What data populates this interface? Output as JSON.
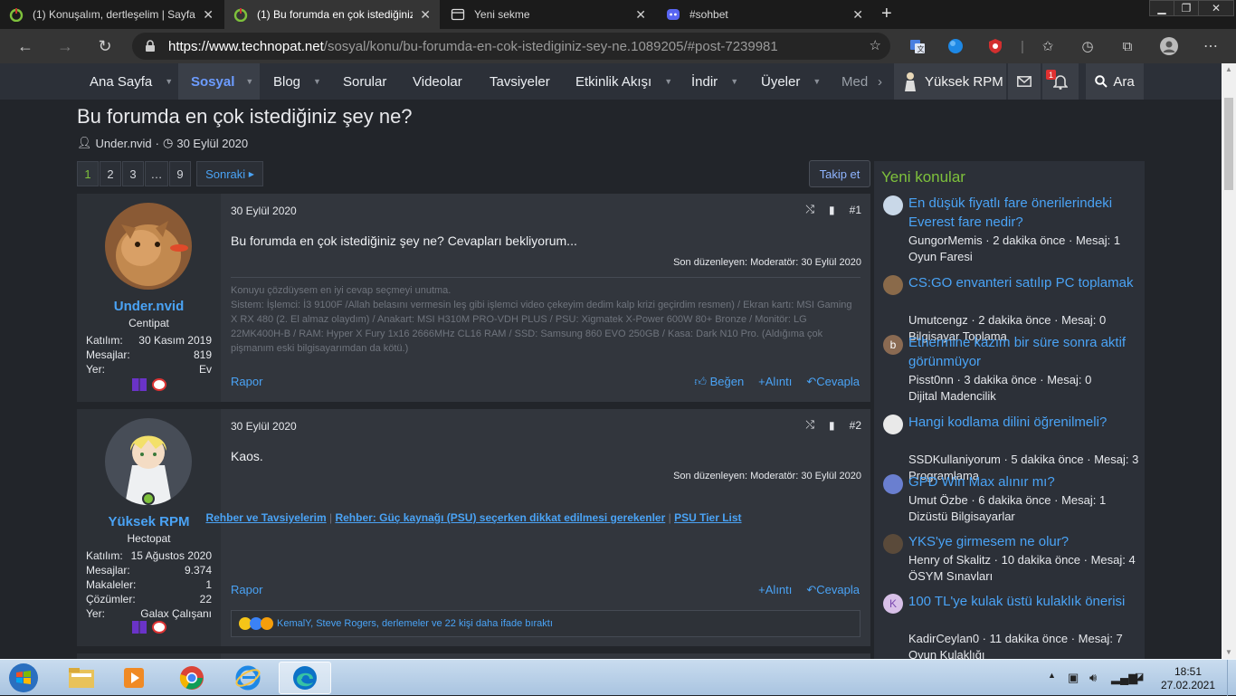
{
  "browser": {
    "tabs": [
      {
        "title": "(1) Konuşalım, dertleşelim | Sayfa",
        "icon": "technopat-icon",
        "active": false
      },
      {
        "title": "(1) Bu forumda en çok istediğiniz",
        "icon": "technopat-icon",
        "active": true
      },
      {
        "title": "Yeni sekme",
        "icon": "new-tab-icon",
        "active": false
      },
      {
        "title": "#sohbet",
        "icon": "discord-icon",
        "active": false
      }
    ],
    "url_domain": "https://www.technopat.net",
    "url_path": "/sosyal/konu/bu-forumda-en-cok-istediginiz-sey-ne.1089205/#post-7239981"
  },
  "forum_nav": {
    "items": [
      "Ana Sayfa",
      "Sosyal",
      "Blog",
      "Sorular",
      "Videolar",
      "Tavsiyeler",
      "Etkinlik Akışı",
      "İndir",
      "Üyeler",
      "Med"
    ],
    "user": "Yüksek RPM",
    "alerts_count": "1",
    "search": "Ara"
  },
  "thread": {
    "title": "Bu forumda en çok istediğiniz şey ne?",
    "author": "Under.nvid",
    "date": "30 Eylül 2020",
    "pages": [
      "1",
      "2",
      "3",
      "…",
      "9"
    ],
    "next": "Sonraki",
    "follow": "Takip et"
  },
  "posts": [
    {
      "username": "Under.nvid",
      "user_title": "Centipat",
      "stats": [
        {
          "k": "Katılım:",
          "v": "30 Kasım 2019"
        },
        {
          "k": "Mesajlar:",
          "v": "819"
        },
        {
          "k": "Yer:",
          "v": "Ev"
        }
      ],
      "date": "30 Eylül 2020",
      "number": "#1",
      "body": "Bu forumda en çok istediğiniz şey ne? Cevapları bekliyorum...",
      "edited": "Son düzenleyen: Moderatör: 30 Eylül 2020",
      "signature": "Konuyu çözdüysem en iyi cevap seçmeyi unutma.\nSistem: İşlemci: İ3 9100F /Allah belasını vermesin leş gibi işlemci video çekeyim dedim kalp krizi geçirdim resmen) / Ekran kartı: MSI Gaming X RX 480 (2. El almaz olaydım) / Anakart: MSI H310M PRO-VDH PLUS / PSU: Xigmatek X-Power 600W 80+ Bronze / Monitör: LG 22MK400H-B / RAM: Hyper X Fury 1x16 2666MHz CL16 RAM / SSD: Samsung 860 EVO 250GB / Kasa: Dark N10 Pro. (Aldığıma çok pişmanım eski bilgisayarımdan da kötü.)",
      "report": "Rapor",
      "like": "Beğen",
      "quote": "Alıntı",
      "reply": "Cevapla"
    },
    {
      "username": "Yüksek RPM",
      "user_title": "Hectopat",
      "stats": [
        {
          "k": "Katılım:",
          "v": "15 Ağustos 2020"
        },
        {
          "k": "Mesajlar:",
          "v": "9.374"
        },
        {
          "k": "Makaleler:",
          "v": "1"
        },
        {
          "k": "Çözümler:",
          "v": "22"
        },
        {
          "k": "Yer:",
          "v": "Galax Çalışanı"
        }
      ],
      "date": "30 Eylül 2020",
      "number": "#2",
      "body": "Kaos.",
      "edited": "Son düzenleyen: Moderatör: 30 Eylül 2020",
      "sig_links": [
        "Rehber ve Tavsiyelerim",
        "Rehber: Güç kaynağı (PSU) seçerken dikkat edilmesi gerekenler",
        "PSU Tier List"
      ],
      "report": "Rapor",
      "quote": "Alıntı",
      "reply": "Cevapla",
      "reactions": "KemalY, Steve Rogers, derlemeler ve 22 kişi daha ifade bıraktı"
    }
  ],
  "sidebar": {
    "title": "Yeni konular",
    "items": [
      {
        "title": "En düşük fiyatlı fare önerilerindeki Everest fare nedir?",
        "meta": "GungorMemis · 2 dakika önce · Mesaj: 1",
        "cat": "Oyun Faresi",
        "av": ""
      },
      {
        "title": "CS:GO envanteri satılıp PC toplamak",
        "meta": "Umutcengz · 2 dakika önce · Mesaj: 0",
        "cat": "Bilgisayar Toplama",
        "av": ""
      },
      {
        "title": "Ethermine kazım bir süre sonra aktif görünmüyor",
        "meta": "Pisst0nn · 3 dakika önce · Mesaj: 0",
        "cat": "Dijital Madencilik",
        "av": "b"
      },
      {
        "title": "Hangi kodlama dilini öğrenilmeli?",
        "meta": "SSDKullaniyorum · 5 dakika önce · Mesaj: 3",
        "cat": "Programlama",
        "av": ""
      },
      {
        "title": "GPD Win Max alınır mı?",
        "meta": "Umut Özbe · 6 dakika önce · Mesaj: 1",
        "cat": "Dizüstü Bilgisayarlar",
        "av": ""
      },
      {
        "title": "YKS'ye girmesem ne olur?",
        "meta": "Henry of Skalitz · 10 dakika önce · Mesaj: 4",
        "cat": "ÖSYM Sınavları",
        "av": ""
      },
      {
        "title": "100 TL'ye kulak üstü kulaklık önerisi",
        "meta": "KadirCeylan0 · 11 dakika önce · Mesaj: 7",
        "cat": "Oyun Kulaklığı",
        "av": "K"
      }
    ]
  },
  "taskbar": {
    "time": "18:51",
    "date": "27.02.2021"
  },
  "colors": {
    "link": "#4aa3f5",
    "accent_green": "#7ec13c",
    "nav_bg": "#2c3038",
    "post_bg": "#32363d"
  }
}
